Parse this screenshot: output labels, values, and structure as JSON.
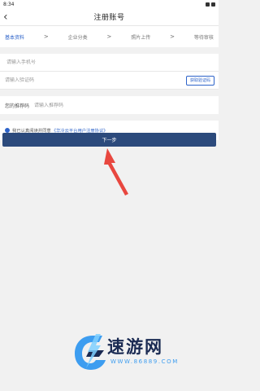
{
  "status_bar": {
    "time": "8:34"
  },
  "header": {
    "back_icon": "chevron-left-icon",
    "title": "注册账号"
  },
  "steps": [
    {
      "label": "基本资料",
      "active": true
    },
    {
      "label": "企业分类",
      "active": false
    },
    {
      "label": "照片上传",
      "active": false
    },
    {
      "label": "等待审核",
      "active": false
    }
  ],
  "step_separator": ">",
  "form": {
    "phone_placeholder": "请输入手机号",
    "code_placeholder": "请输入验证码",
    "code_button": "获取验证码",
    "referrer_label": "您的推荐码",
    "referrer_placeholder": "请输入推荐码"
  },
  "agreement": {
    "text": "我已认真阅读并同意",
    "link": "《华冷云平台用户注册协议》",
    "checked": true
  },
  "next_button": "下一步",
  "watermark": {
    "brand": "速游网",
    "url": "WWW.86889.COM"
  },
  "colors": {
    "accent": "#2d63c9",
    "button": "#2c4a7c",
    "arrow": "#e8473f"
  }
}
